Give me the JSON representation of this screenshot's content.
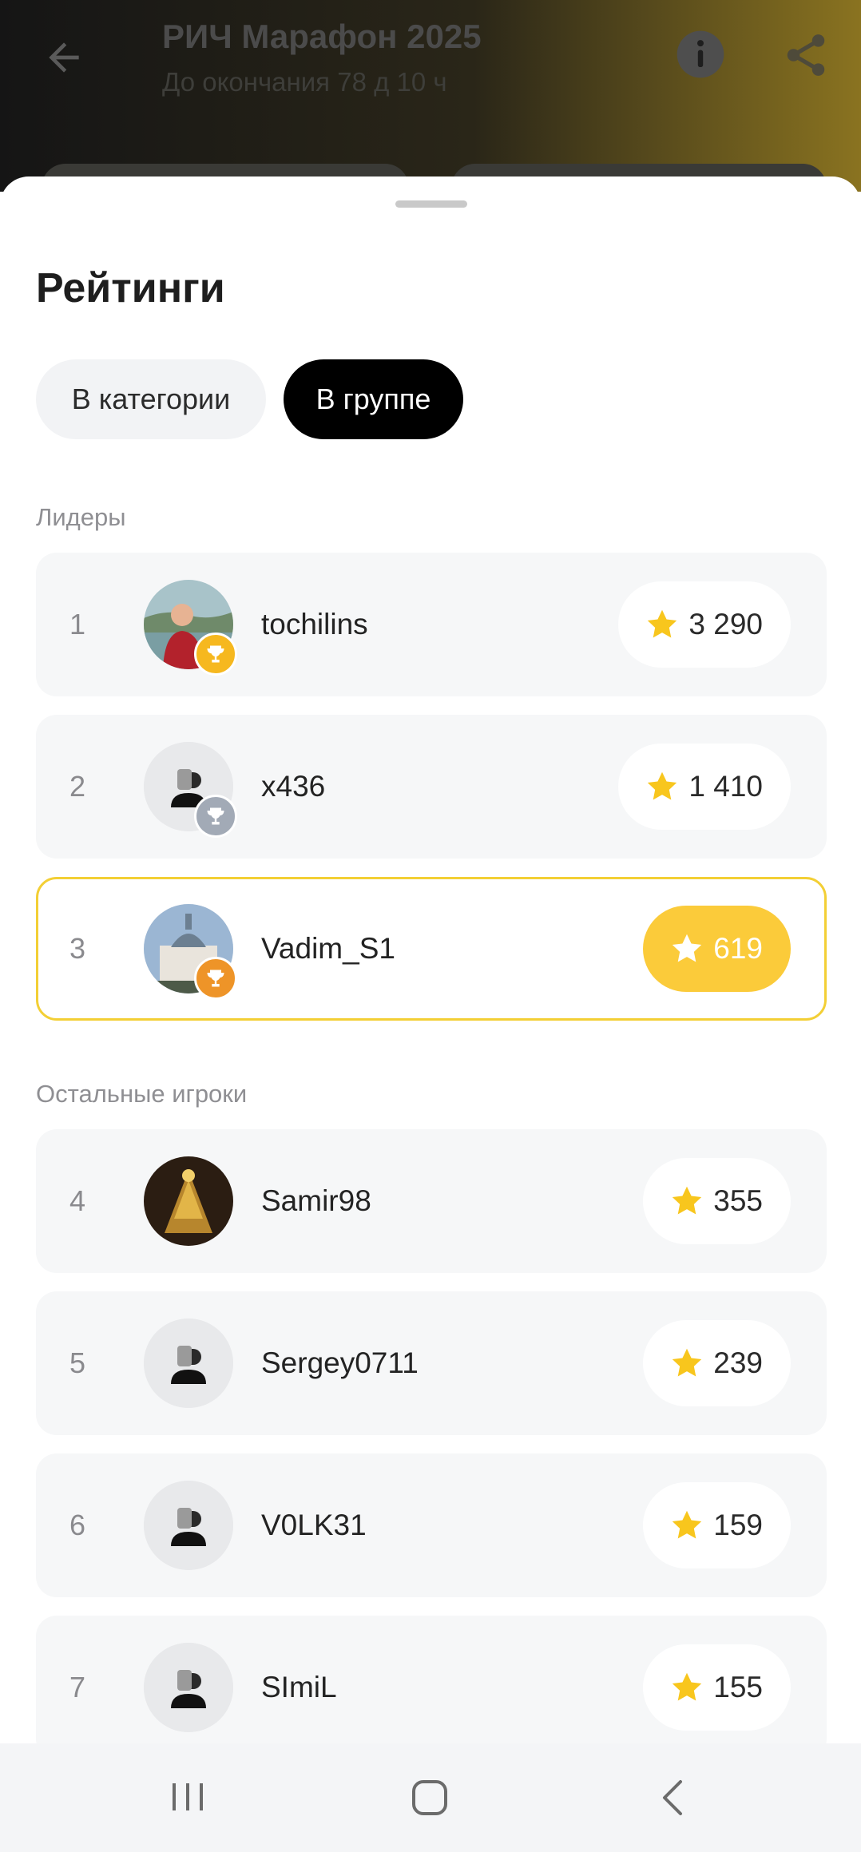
{
  "header": {
    "title": "РИЧ Марафон 2025",
    "subtitle": "До окончания 78 д 10 ч",
    "back_icon": "arrow-left-icon",
    "info_icon": "info-icon",
    "share_icon": "share-icon"
  },
  "sheet": {
    "title": "Рейтинги",
    "tabs": [
      {
        "label": "В категории",
        "active": false
      },
      {
        "label": "В группе",
        "active": true
      }
    ],
    "leaders_label": "Лидеры",
    "others_label": "Остальные игроки"
  },
  "leaders": [
    {
      "rank": "1",
      "name": "tochilins",
      "score": "3 290",
      "trophy": "gold",
      "avatar": "photo"
    },
    {
      "rank": "2",
      "name": "x436",
      "score": "1 410",
      "trophy": "silver",
      "avatar": "default"
    },
    {
      "rank": "3",
      "name": "Vadim_S1",
      "score": "619",
      "trophy": "bronze",
      "avatar": "photo",
      "current_user": true
    }
  ],
  "others": [
    {
      "rank": "4",
      "name": "Samir98",
      "score": "355",
      "avatar": "photo"
    },
    {
      "rank": "5",
      "name": "Sergey0711",
      "score": "239",
      "avatar": "default"
    },
    {
      "rank": "6",
      "name": "V0LK31",
      "score": "159",
      "avatar": "default"
    },
    {
      "rank": "7",
      "name": "SImiL",
      "score": "155",
      "avatar": "default"
    }
  ],
  "colors": {
    "accent": "#fbcb3a",
    "highlight_border": "#f3cf35",
    "gold": "#f6b81f",
    "silver": "#a2aab6",
    "bronze": "#ee9428",
    "star": "#f8c61d"
  },
  "system_nav": {
    "recent_icon": "recent-apps-icon",
    "home_icon": "home-icon",
    "back_icon": "back-icon"
  }
}
